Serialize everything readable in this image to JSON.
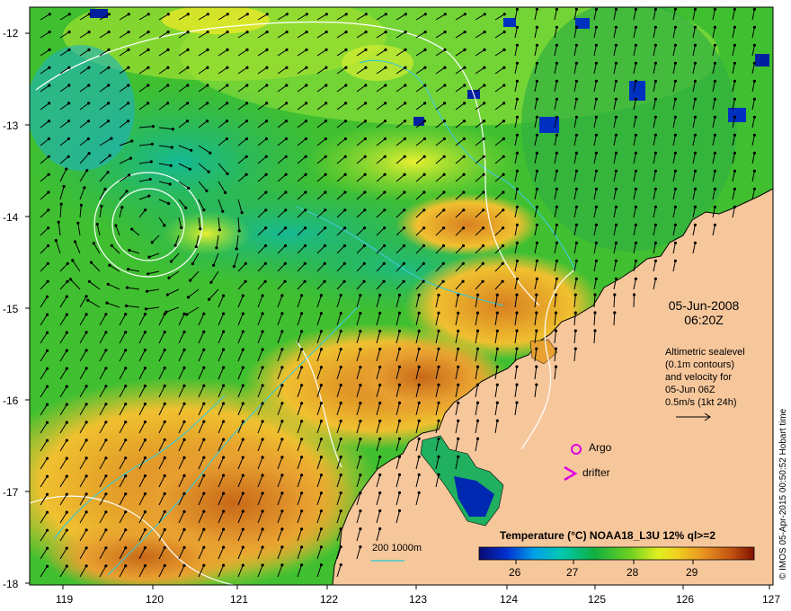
{
  "axes": {
    "lon_ticks": [
      "119",
      "120",
      "121",
      "122",
      "123",
      "124",
      "125",
      "126",
      "127"
    ],
    "lat_ticks": [
      "-12",
      "-13",
      "-14",
      "-15",
      "-16",
      "-17",
      "-18"
    ]
  },
  "timestamp": {
    "date": "05-Jun-2008",
    "time": "06:20Z"
  },
  "altimetry_note": {
    "line1": "Altimetric sealevel",
    "line2": "(0.1m contours)",
    "line3": "and velocity for",
    "line4": "05-Jun 06Z",
    "line5": "0.5m/s (1kt 24h)"
  },
  "legend": {
    "argo": "Argo",
    "drifter": "drifter",
    "isobaths": "200  1000m"
  },
  "colorbar": {
    "title": "Temperature (°C) NOAA18_L3U 12% ql>=2",
    "ticks": [
      "26",
      "27",
      "28",
      "29"
    ]
  },
  "credit": "© IMOS 05-Apr-2015 00:50:52 Hobart time",
  "colors": {
    "land": "#f7c79c",
    "argo_marker": "#e000e0",
    "drifter_marker": "#e000e0",
    "isobath_200": "#40c8d0",
    "sealevel_contour": "#ffffff"
  }
}
